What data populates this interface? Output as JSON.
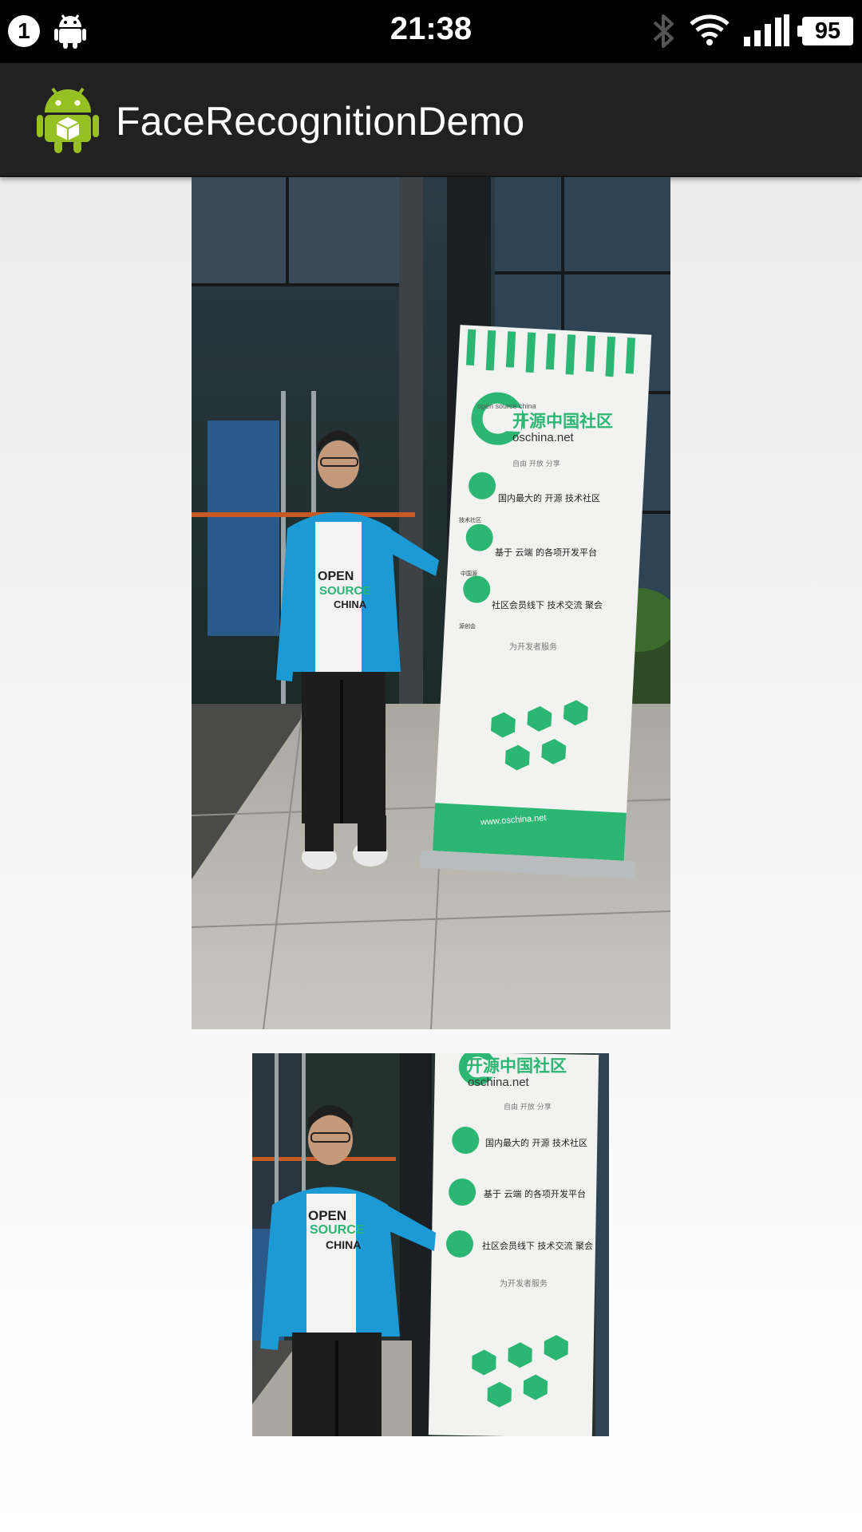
{
  "status_bar": {
    "notification_count": "1",
    "time": "21:38",
    "battery_level": "95",
    "icons": [
      "android-debug-icon",
      "bluetooth-icon",
      "wifi-icon",
      "cell-signal-icon",
      "battery-icon"
    ]
  },
  "action_bar": {
    "title": "FaceRecognitionDemo",
    "icon": "android-app-icon"
  },
  "images": {
    "original": {
      "banner": {
        "brand_en": "open source china",
        "brand_cn": "开源中国社区",
        "brand_url": "oschina.net",
        "tagline": "自由 开放 分享",
        "row1": "国内最大的 开源 技术社区",
        "row1_tag": "技术社区",
        "row2": "基于 云端 的各项开发平台",
        "row2_tag": "中国源",
        "row3": "社区会员线下 技术交流 聚会",
        "row3_tag": "源创会",
        "section": "为开发者服务",
        "footer_url": "www.oschina.net"
      },
      "shirt": [
        "OPEN",
        "SOURCE",
        "CHINA"
      ]
    },
    "face_crop": {
      "banner": {
        "brand_cn": "开源中国社区",
        "brand_url": "oschina.net",
        "tagline": "自由 开放 分享",
        "row1": "国内最大的 开源 技术社区",
        "row2": "基于 云端 的各项开发平台",
        "row3": "社区会员线下 技术交流 聚会",
        "section": "为开发者服务"
      },
      "shirt": [
        "OPEN",
        "SOURCE",
        "CHINA"
      ]
    }
  },
  "colors": {
    "status_bar_bg": "#000000",
    "action_bar_bg": "#212121",
    "accent_green": "#2bb673",
    "jacket_blue": "#1c9ad6"
  }
}
